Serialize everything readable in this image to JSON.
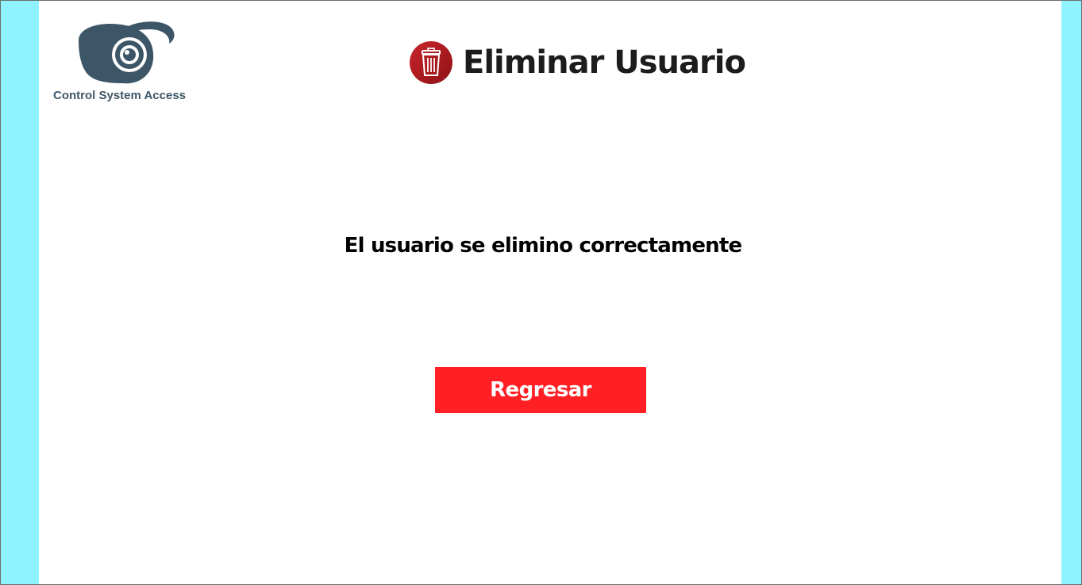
{
  "logo": {
    "text": "Control System Access",
    "icon": "security-camera-icon",
    "color": "#3d5667"
  },
  "header": {
    "title": "Eliminar Usuario",
    "icon": "trash-icon",
    "icon_color": "#a6171c"
  },
  "main": {
    "message": "El usuario se elimino correctamente"
  },
  "actions": {
    "back_label": "Regresar",
    "back_color": "#ff1f24"
  },
  "colors": {
    "side_accent": "#8ef3ff",
    "panel": "#ffffff"
  }
}
